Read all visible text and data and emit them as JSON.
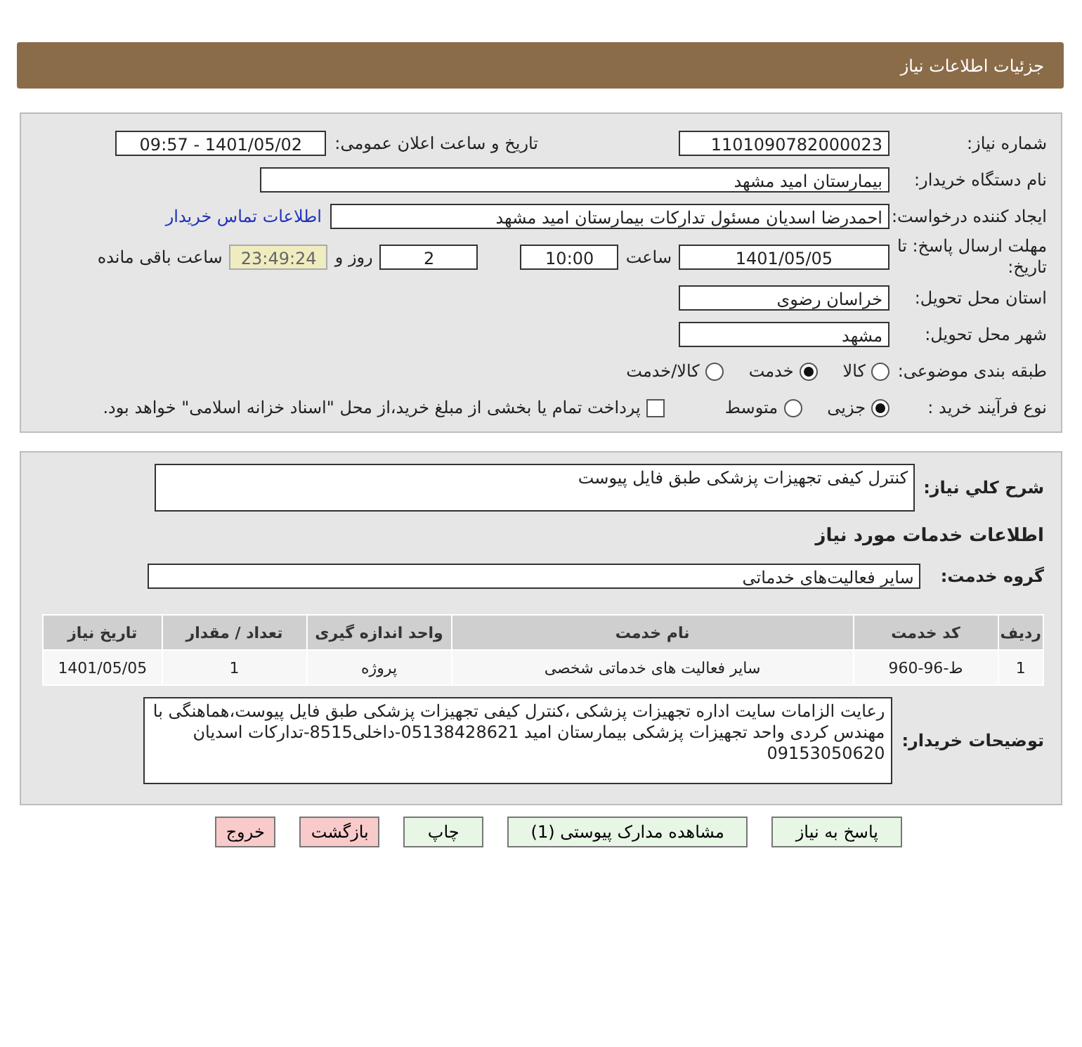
{
  "page_title": "جزئیات اطلاعات نیاز",
  "need_number": {
    "label": "شماره نیاز:",
    "value": "1101090782000023"
  },
  "announce": {
    "label": "تاریخ و ساعت اعلان عمومی:",
    "value": "1401/05/02 - 09:57"
  },
  "buyer_org": {
    "label": "نام دستگاه خریدار:",
    "value": "بیمارستان امید مشهد"
  },
  "requester": {
    "label": "ایجاد کننده درخواست:",
    "value": "احمدرضا اسدیان مسئول تدارکات بیمارستان امید مشهد",
    "link": "اطلاعات تماس خریدار"
  },
  "deadline": {
    "label": "مهلت ارسال پاسخ: تا تاریخ:",
    "date": "1401/05/05",
    "time_label": "ساعت",
    "time": "10:00",
    "days": "2",
    "days_label": "روز و",
    "remaining": "23:49:24",
    "remaining_label": "ساعت باقی مانده"
  },
  "province": {
    "label": "استان محل تحویل:",
    "value": "خراسان رضوی"
  },
  "city": {
    "label": "شهر محل تحویل:",
    "value": "مشهد"
  },
  "category": {
    "label": "طبقه بندی موضوعی:",
    "options": [
      {
        "label": "کالا",
        "selected": false
      },
      {
        "label": "خدمت",
        "selected": true
      },
      {
        "label": "کالا/خدمت",
        "selected": false
      }
    ]
  },
  "process": {
    "label": "نوع فرآیند خرید :",
    "options": [
      {
        "label": "جزیی",
        "selected": true
      },
      {
        "label": "متوسط",
        "selected": false
      }
    ],
    "payment": {
      "label": "پرداخت تمام یا بخشی از مبلغ خرید،از محل \"اسناد خزانه اسلامی\" خواهد بود.",
      "checked": false
    }
  },
  "summary": {
    "label": "شرح کلي نياز:",
    "value": "کنترل کیفی تجهیزات پزشکی طبق فایل پیوست"
  },
  "services_heading": "اطلاعات خدمات مورد نیاز",
  "service_group": {
    "label": "گروه خدمت:",
    "value": "سایر فعالیت‌های خدماتی"
  },
  "table": {
    "columns": [
      "ردیف",
      "کد خدمت",
      "نام خدمت",
      "واحد اندازه گیری",
      "تعداد / مقدار",
      "تاریخ نیاز"
    ],
    "rows": [
      [
        "1",
        "ط-96-960",
        "سایر فعالیت های خدماتی شخصی",
        "پروژه",
        "1",
        "1401/05/05"
      ]
    ]
  },
  "buyer_notes": {
    "label": "توضیحات خریدار:",
    "value": "رعایت الزامات سایت اداره تجهیزات پزشکی ،کنترل کیفی تجهیزات پزشکی طبق فایل پیوست،هماهنگی با مهندس کردی واحد تجهیزات پزشکی بیمارستان امید 05138428621-داخلی8515-تدارکات اسدیان 09153050620"
  },
  "buttons": [
    {
      "label": "پاسخ به نیاز",
      "kind": "primary"
    },
    {
      "label": "مشاهده مدارک پیوستی (1)",
      "kind": "primary"
    },
    {
      "label": "چاپ",
      "kind": "primary"
    },
    {
      "label": "بازگشت",
      "kind": "danger"
    },
    {
      "label": "خروج",
      "kind": "danger"
    }
  ]
}
